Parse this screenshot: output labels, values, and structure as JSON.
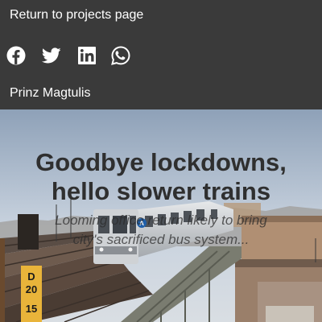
{
  "nav": {
    "back_link": "Return to projects page"
  },
  "social": {
    "icons": [
      "facebook-icon",
      "twitter-icon",
      "linkedin-icon",
      "whatsapp-icon"
    ]
  },
  "author": {
    "name": "Prinz Magtulis"
  },
  "hero": {
    "title_line1": "Goodbye lockdowns,",
    "title_line2": "hello slower trains",
    "subtitle_line1": "Looming office return likely to bring",
    "subtitle_line2": "city's sacrificed bus system...",
    "train_sign_line1": "D",
    "train_sign_line2": "20",
    "train_sign_line3": "15",
    "train_route": "A"
  },
  "colors": {
    "header_bg": "#3a3a3a",
    "header_text": "#ffffff",
    "hero_title": "#2f2f2f"
  }
}
